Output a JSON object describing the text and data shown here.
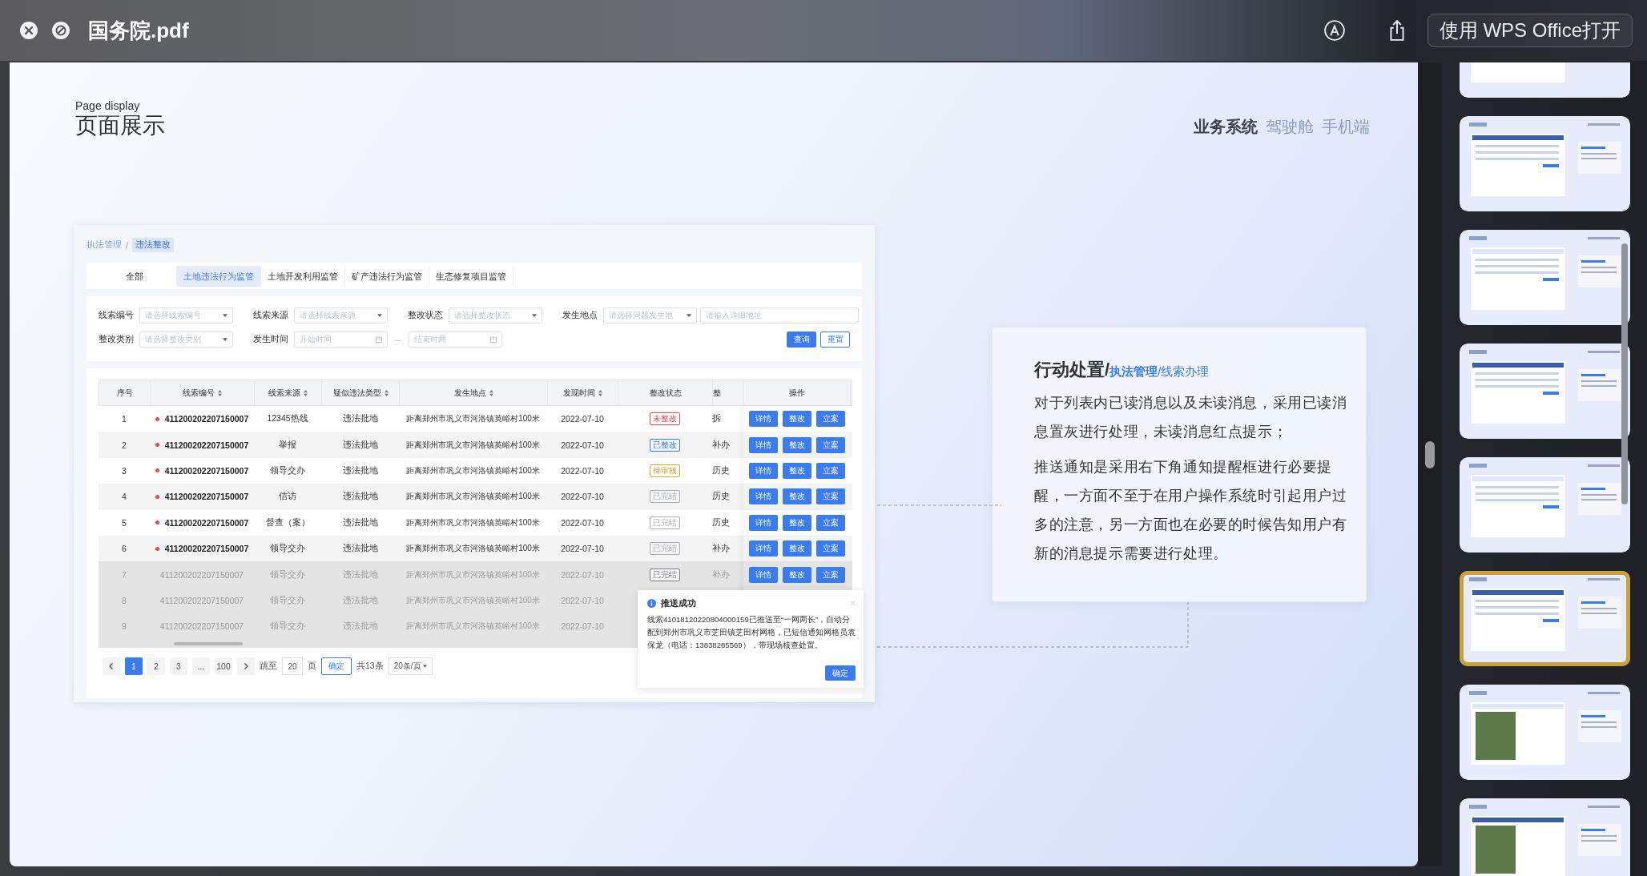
{
  "window": {
    "title": "国务院.pdf",
    "open_button": "使用 WPS Office打开"
  },
  "slide": {
    "subtitle": "Page display",
    "title": "页面展示",
    "tabs": [
      {
        "label": "业务系统",
        "selected": true
      },
      {
        "label": "驾驶舱",
        "selected": false
      },
      {
        "label": "手机端",
        "selected": false
      }
    ],
    "screenshot": {
      "breadcrumb_separator": "/",
      "breadcrumb": [
        {
          "label": "执法管理",
          "selected": false
        },
        {
          "label": "违法整改",
          "selected": true
        }
      ],
      "tabs": [
        {
          "label": "全部",
          "selected": false
        },
        {
          "label": "土地违法行为监管",
          "selected": true
        },
        {
          "label": "土地开发利用监管",
          "selected": false
        },
        {
          "label": "矿产违法行为监管",
          "selected": false
        },
        {
          "label": "生态修复项目监管",
          "selected": false
        }
      ],
      "filters": [
        {
          "groups": [
            {
              "label": "线索编号",
              "fields": [
                {
                  "kind": "select",
                  "placeholder": "请选择线索编号"
                }
              ]
            },
            {
              "label": "线索来源",
              "fields": [
                {
                  "kind": "select",
                  "placeholder": "请选择线索来源"
                }
              ]
            },
            {
              "label": "整改状态",
              "fields": [
                {
                  "kind": "select",
                  "placeholder": "请选择整改状态"
                }
              ]
            },
            {
              "label": "发生地点",
              "fields": [
                {
                  "kind": "select",
                  "placeholder": "请选择问题发生地"
                },
                {
                  "kind": "input",
                  "placeholder": "请输入详细地址"
                }
              ]
            }
          ]
        },
        {
          "groups": [
            {
              "label": "整改类别",
              "fields": [
                {
                  "kind": "select",
                  "placeholder": "请选择整改类别"
                }
              ]
            },
            {
              "label": "发生时间",
              "fields": [
                {
                  "kind": "date",
                  "placeholder": "开始时间"
                },
                {
                  "kind": "separator",
                  "text": "—"
                },
                {
                  "kind": "date",
                  "placeholder": "结束时间"
                }
              ]
            }
          ]
        }
      ],
      "buttons": [
        {
          "label": "查询",
          "primary": true
        },
        {
          "label": "重置",
          "primary": false
        }
      ],
      "table": {
        "columns": [
          {
            "label": "序号",
            "sortable": false
          },
          {
            "label": "线索编号",
            "sortable": true
          },
          {
            "label": "线索来源",
            "sortable": true
          },
          {
            "label": "疑似违法类型",
            "sortable": true
          },
          {
            "label": "发生地点",
            "sortable": true
          },
          {
            "label": "发现时间",
            "sortable": true
          },
          {
            "label": "整改状态",
            "sortable": false
          },
          {
            "label": "整",
            "sortable": false
          },
          {
            "label": "操作",
            "sortable": false
          }
        ],
        "rows": [
          {
            "no": "1",
            "code": "411200202207150007",
            "source": "12345热线",
            "type": "违法批地",
            "place": "距离郑州市巩义市河洛镇英峪村100米",
            "time": "2022-07-10",
            "status": {
              "label": "未整改",
              "color": "#e5484d"
            },
            "column_8": "拆",
            "actions": [
              "详情",
              "整改",
              "立案"
            ],
            "unread": true
          },
          {
            "no": "2",
            "code": "411200202207150007",
            "source": "举报",
            "type": "违法批地",
            "place": "距离郑州市巩义市河洛镇英峪村100米",
            "time": "2022-07-10",
            "status": {
              "label": "已整改",
              "color": "#3a7bf0"
            },
            "column_8": "补办",
            "actions": [
              "详情",
              "整改",
              "立案"
            ],
            "unread": true
          },
          {
            "no": "3",
            "code": "411200202207150007",
            "source": "领导交办",
            "type": "违法批地",
            "place": "距离郑州市巩义市河洛镇英峪村100米",
            "time": "2022-07-10",
            "status": {
              "label": "待审核",
              "color": "#d4a72c"
            },
            "column_8": "历史",
            "actions": [
              "详情",
              "整改",
              "立案"
            ],
            "unread": true
          },
          {
            "no": "4",
            "code": "411200202207150007",
            "source": "信访",
            "type": "违法批地",
            "place": "距离郑州市巩义市河洛镇英峪村100米",
            "time": "2022-07-10",
            "status": {
              "label": "已完结",
              "color": "#a9adb4"
            },
            "column_8": "历史",
            "actions": [
              "详情",
              "整改",
              "立案"
            ],
            "unread": true
          },
          {
            "no": "5",
            "code": "411200202207150007",
            "source": "督查（案）",
            "type": "违法批地",
            "place": "距离郑州市巩义市河洛镇英峪村100米",
            "time": "2022-07-10",
            "status": {
              "label": "已完结",
              "color": "#a9adb4"
            },
            "column_8": "历史",
            "actions": [
              "详情",
              "整改",
              "立案"
            ],
            "unread": true
          },
          {
            "no": "6",
            "code": "411200202207150007",
            "source": "领导交办",
            "type": "违法批地",
            "place": "距离郑州市巩义市河洛镇英峪村100米",
            "time": "2022-07-10",
            "status": {
              "label": "已完结",
              "color": "#a9adb4"
            },
            "column_8": "补办",
            "actions": [
              "详情",
              "整改",
              "立案"
            ],
            "unread": true
          },
          {
            "no": "7",
            "code": "411200202207150007",
            "source": "领导交办",
            "type": "违法批地",
            "place": "距离郑州市巩义市河洛镇英峪村100米",
            "time": "2022-07-10",
            "status": {
              "label": "已完结",
              "color": "#7d8189"
            },
            "column_8": "补办",
            "actions": [
              "详情",
              "整改",
              "立案"
            ],
            "unread": false
          },
          {
            "no": "8",
            "code": "411200202207150007",
            "source": "领导交办",
            "type": "违法批地",
            "place": "距离郑州市巩义市河洛镇英峪村100米",
            "time": "2022-07-10",
            "unread": false
          },
          {
            "no": "9",
            "code": "411200202207150007",
            "source": "领导交办",
            "type": "违法批地",
            "place": "距离郑州市巩义市河洛镇英峪村100米",
            "time": "2022-07-10",
            "unread": false
          }
        ]
      },
      "pagination": {
        "pages": [
          {
            "label": "1",
            "selected": true
          },
          {
            "label": "2",
            "selected": false
          },
          {
            "label": "3",
            "selected": false
          },
          {
            "label": "...",
            "selected": false
          },
          {
            "label": "100",
            "selected": false
          }
        ],
        "jump_label": "跳至",
        "jump_value": "20",
        "page_unit": "页",
        "confirm": "确定",
        "total": "共13条",
        "page_size": "20条/页"
      },
      "notification": {
        "title": "推送成功",
        "text": "线索41018120220804000159已推送至“一网两长”，自动分配到郑州市巩义市芝田镇芝田村网格，已短信通知网格员袁保龙（电话：13838285569），带现场核查处置。",
        "button": "确定"
      }
    },
    "card": {
      "title": "行动处置/",
      "path": "**执法管理**/线索办理",
      "paragraphs": [
        "对于列表内已读消息以及未读消息，采用已读消息置灰进行处理，未读消息红点提示；",
        "推送通知是采用右下角通知提醒框进行必要提醒，一方面不至于在用户操作系统时引起用户过多的注意，另一方面也在必要的时候告知用户有新的消息提示需要进行处理。"
      ]
    }
  },
  "thumbnails": [
    {
      "selected": false
    },
    {
      "selected": false
    },
    {
      "selected": false
    },
    {
      "selected": false
    },
    {
      "selected": false
    },
    {
      "selected": true
    },
    {
      "selected": false
    },
    {
      "selected": false
    }
  ]
}
